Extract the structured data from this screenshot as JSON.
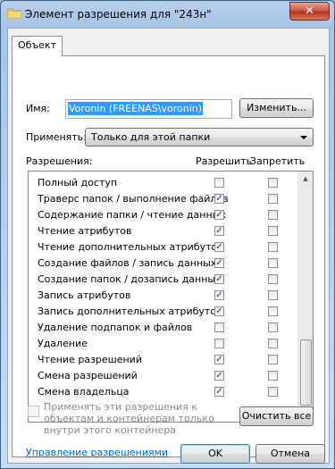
{
  "window": {
    "title": "Элемент разрешения для \"243н\"",
    "close_glyph": "✕"
  },
  "tab": {
    "label": "Объект"
  },
  "principal": {
    "label": "Имя:",
    "value": "Voronin (FREENAS\\voronin)",
    "change_button": "Изменить..."
  },
  "apply_to": {
    "label": "Применять:",
    "selected": "Только для этой папки"
  },
  "permissions": {
    "header_label": "Разрешения:",
    "allow_header": "Разрешить",
    "deny_header": "Запретить",
    "items": [
      {
        "name": "Полный доступ",
        "allow": false,
        "deny": false
      },
      {
        "name": "Траверс папок / выполнение файлов",
        "allow": true,
        "deny": false
      },
      {
        "name": "Содержание папки / чтение данных",
        "allow": true,
        "deny": false
      },
      {
        "name": "Чтение атрибутов",
        "allow": true,
        "deny": false
      },
      {
        "name": "Чтение дополнительных атрибутов",
        "allow": true,
        "deny": false
      },
      {
        "name": "Создание файлов / запись данных",
        "allow": true,
        "deny": false
      },
      {
        "name": "Создание папок / дозапись данных",
        "allow": true,
        "deny": false
      },
      {
        "name": "Запись атрибутов",
        "allow": true,
        "deny": false
      },
      {
        "name": "Запись дополнительных атрибутов",
        "allow": true,
        "deny": false
      },
      {
        "name": "Удаление подпапок и файлов",
        "allow": false,
        "deny": false
      },
      {
        "name": "Удаление",
        "allow": false,
        "deny": false
      },
      {
        "name": "Чтение разрешений",
        "allow": true,
        "deny": false
      },
      {
        "name": "Смена разрешений",
        "allow": true,
        "deny": false
      },
      {
        "name": "Смена владельца",
        "allow": true,
        "deny": false
      }
    ]
  },
  "apply_children": {
    "text": "Применять эти разрешения к объектам и контейнерам только внутри этого контейнера",
    "checked": false
  },
  "clear_all_button": "Очистить все",
  "manage_link": "Управление разрешениями",
  "footer": {
    "ok": "OK",
    "cancel": "Отмена"
  },
  "colors": {
    "accent": "#3399ff",
    "link": "#0066cc",
    "close": "#c0442f",
    "check": "#1c3f7a"
  }
}
